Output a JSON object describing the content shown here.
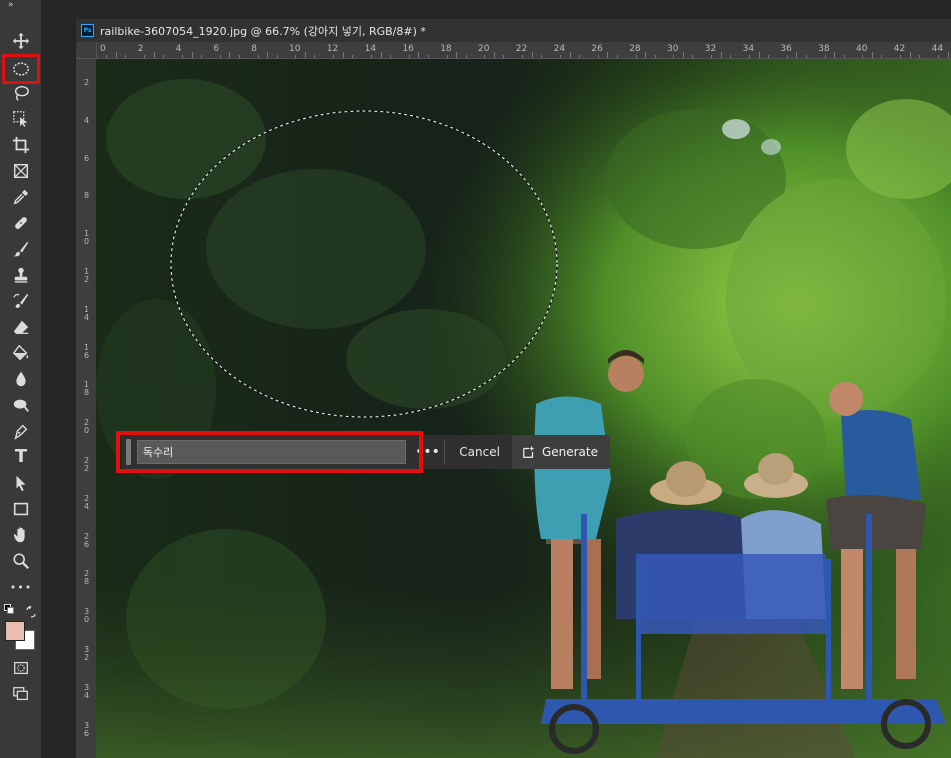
{
  "toolbar": {
    "collapse_glyph": "»",
    "tools": [
      {
        "name": "move-tool",
        "icon": "move-icon"
      },
      {
        "name": "elliptical-marquee-tool",
        "icon": "ellipse-marquee-icon",
        "active": true
      },
      {
        "name": "lasso-tool",
        "icon": "lasso-icon"
      },
      {
        "name": "object-selection-tool",
        "icon": "object-selection-icon"
      },
      {
        "name": "crop-tool",
        "icon": "crop-icon"
      },
      {
        "name": "frame-tool",
        "icon": "frame-icon"
      },
      {
        "name": "eyedropper-tool",
        "icon": "eyedropper-icon"
      },
      {
        "name": "healing-brush-tool",
        "icon": "bandage-icon"
      },
      {
        "name": "brush-tool",
        "icon": "brush-icon"
      },
      {
        "name": "clone-stamp-tool",
        "icon": "stamp-icon"
      },
      {
        "name": "history-brush-tool",
        "icon": "history-brush-icon"
      },
      {
        "name": "eraser-tool",
        "icon": "eraser-icon"
      },
      {
        "name": "paint-bucket-tool",
        "icon": "paint-bucket-icon"
      },
      {
        "name": "blur-tool",
        "icon": "drop-icon"
      },
      {
        "name": "dodge-tool",
        "icon": "dodge-icon"
      },
      {
        "name": "pen-tool",
        "icon": "pen-icon"
      },
      {
        "name": "type-tool",
        "icon": "type-icon"
      },
      {
        "name": "path-selection-tool",
        "icon": "arrow-icon"
      },
      {
        "name": "rectangle-tool",
        "icon": "rectangle-icon"
      },
      {
        "name": "hand-tool",
        "icon": "hand-icon"
      },
      {
        "name": "zoom-tool",
        "icon": "zoom-icon"
      },
      {
        "name": "edit-toolbar",
        "icon": "more-icon"
      }
    ],
    "foreground_color": "#e8bfae",
    "background_color": "#ffffff"
  },
  "document": {
    "title": "railbike-3607054_1920.jpg @ 66.7% (강아지 넣기, RGB/8#) *",
    "ps_badge": "Ps"
  },
  "ruler": {
    "top_labels": [
      "0",
      "2",
      "4",
      "6",
      "8",
      "10",
      "12",
      "14",
      "16",
      "18",
      "20",
      "22",
      "24",
      "26",
      "28",
      "30",
      "32",
      "34",
      "36",
      "38",
      "40",
      "42",
      "44"
    ],
    "left_labels": [
      "2",
      "4",
      "6",
      "8",
      "1\n0",
      "1\n2",
      "1\n4",
      "1\n6",
      "1\n8",
      "2\n0",
      "2\n2",
      "2\n4",
      "2\n6",
      "2\n8",
      "3\n0",
      "3\n2",
      "3\n4",
      "3\n6"
    ]
  },
  "taskbar": {
    "prompt_value": "독수리",
    "more_glyph": "•••",
    "cancel_label": "Cancel",
    "generate_label": "Generate"
  },
  "colors": {
    "highlight": "#e01010",
    "accent": "#31a8ff"
  }
}
